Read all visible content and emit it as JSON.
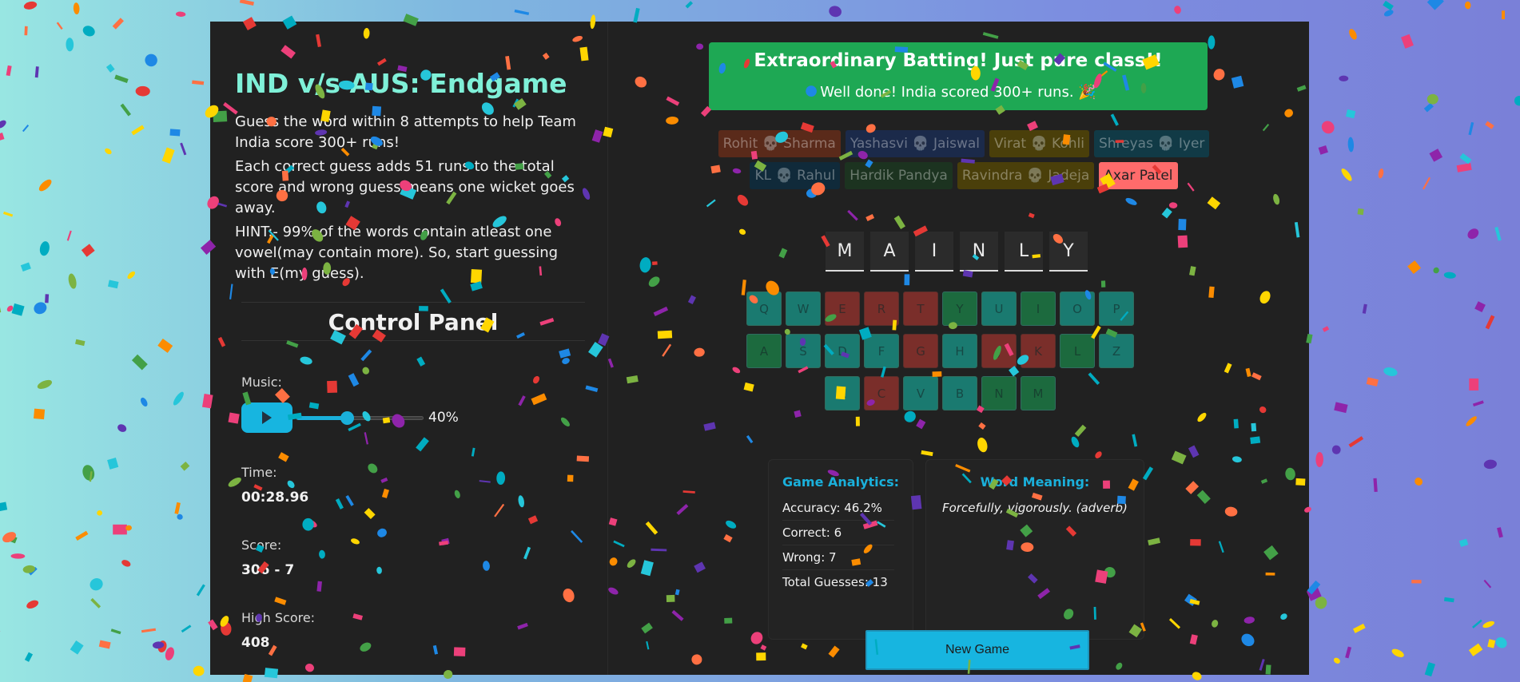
{
  "game": {
    "title": "IND v/s AUS: Endgame",
    "desc1": "Guess the word within 8 attempts to help Team India score 300+ runs!",
    "desc2": "Each correct guess adds 51 runs to the total score and wrong guess means one wicket goes away.",
    "desc3": "HINT:- 99% of the words contain atleast one vowel(may contain more). So, start guessing with E(my guess)."
  },
  "control_panel": {
    "title": "Control Panel",
    "music_label": "Music:",
    "volume_label": "40%",
    "volume": 0.4,
    "time_label": "Time:",
    "time_value": "00:28.96",
    "score_label": "Score:",
    "score_value": "306 - 7",
    "high_label": "High Score:",
    "high_value": "408"
  },
  "banner": {
    "title": "Extraordinary Batting! Just pure class!!",
    "subtitle": "Well done! India scored 300+ runs. 🎉",
    "color": "#1ea854"
  },
  "players": [
    [
      {
        "name": "Rohit Sharma",
        "out": true,
        "color": "#5a2a1a"
      },
      {
        "name": "Yashasvi Jaiswal",
        "out": true,
        "color": "#1b2a4a"
      },
      {
        "name": "Virat Kohli",
        "out": true,
        "color": "#4a3f0a"
      },
      {
        "name": "Shreyas Iyer",
        "out": true,
        "color": "#113a46"
      }
    ],
    [
      {
        "name": "KL Rahul",
        "out": true,
        "color": "#102a3a"
      },
      {
        "name": "Hardik Pandya",
        "out": false,
        "color": "#1c3320"
      },
      {
        "name": "Ravindra Jadeja",
        "out": true,
        "color": "#4a3f0a"
      },
      {
        "name": "Axar Patel",
        "out": false,
        "color": "#ff6b6b",
        "active": true
      }
    ]
  ],
  "skull": "💀",
  "word": [
    "M",
    "A",
    "I",
    "N",
    "L",
    "Y"
  ],
  "keyboard": [
    [
      [
        "Q",
        "unused"
      ],
      [
        "W",
        "unused"
      ],
      [
        "E",
        "wrong"
      ],
      [
        "R",
        "wrong"
      ],
      [
        "T",
        "wrong"
      ],
      [
        "Y",
        "correct"
      ],
      [
        "U",
        "unused"
      ],
      [
        "I",
        "correct"
      ],
      [
        "O",
        "unused"
      ],
      [
        "P",
        "unused"
      ]
    ],
    [
      [
        "A",
        "correct"
      ],
      [
        "S",
        "unused"
      ],
      [
        "D",
        "unused"
      ],
      [
        "F",
        "unused"
      ],
      [
        "G",
        "wrong"
      ],
      [
        "H",
        "unused"
      ],
      [
        "J",
        "wrong"
      ],
      [
        "K",
        "wrong"
      ],
      [
        "L",
        "correct"
      ],
      [
        "Z",
        "unused"
      ]
    ],
    [
      [
        "X",
        "unused"
      ],
      [
        "C",
        "wrong"
      ],
      [
        "V",
        "unused"
      ],
      [
        "B",
        "unused"
      ],
      [
        "N",
        "correct"
      ],
      [
        "M",
        "correct"
      ]
    ]
  ],
  "analytics": {
    "title": "Game Analytics:",
    "accuracy": "Accuracy: 46.2%",
    "correct": "Correct: 6",
    "wrong": "Wrong: 7",
    "total": "Total Guesses: 13"
  },
  "meaning": {
    "title": "Word Meaning:",
    "text": "Forcefully, vigorously. (adverb)"
  },
  "new_game_label": "New Game"
}
